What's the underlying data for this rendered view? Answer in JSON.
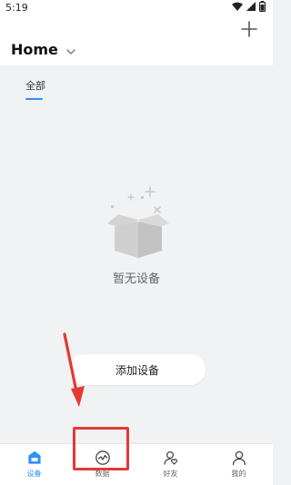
{
  "status_bar": {
    "time": "5:19",
    "icons": [
      "wifi-icon",
      "signal-icon",
      "battery-icon"
    ]
  },
  "header": {
    "title": "Home",
    "add_icon": "plus-icon",
    "dropdown_icon": "chevron-down-icon"
  },
  "tabs": [
    {
      "label": "全部",
      "active": true
    }
  ],
  "empty_state": {
    "message": "暂无设备",
    "illustration_icon": "empty-box-icon"
  },
  "add_device_button": {
    "label": "添加设备"
  },
  "bottom_nav": {
    "items": [
      {
        "label": "设备",
        "icon": "device-home-icon",
        "active": true
      },
      {
        "label": "数据",
        "icon": "data-chart-icon",
        "active": false
      },
      {
        "label": "好友",
        "icon": "friends-icon",
        "active": false
      },
      {
        "label": "我的",
        "icon": "profile-icon",
        "active": false
      }
    ]
  },
  "colors": {
    "accent": "#2e90f5",
    "background": "#f1f2f4",
    "annotation": "#e53935"
  }
}
